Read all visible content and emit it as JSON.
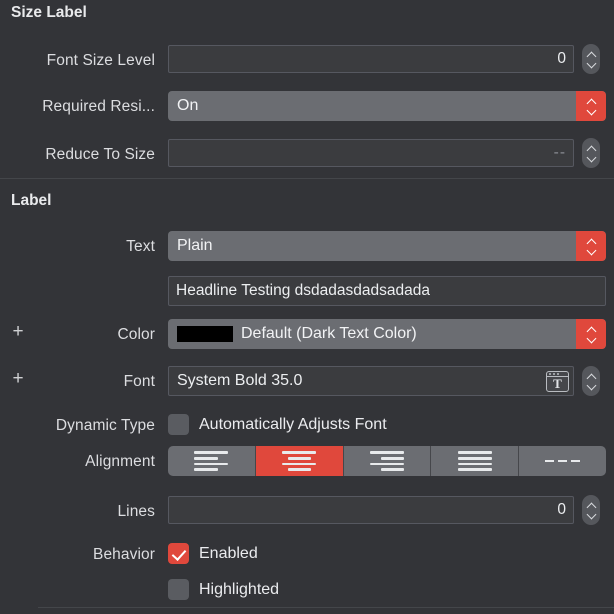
{
  "sections": {
    "size_label": {
      "title": "Size Label"
    },
    "label": {
      "title": "Label"
    }
  },
  "rows": {
    "font_size_level": {
      "label": "Font Size Level",
      "value": "0"
    },
    "required_resistance": {
      "label": "Required Resi...",
      "value": "On"
    },
    "reduce_to_size": {
      "label": "Reduce To Size",
      "value": "--"
    },
    "text": {
      "label": "Text",
      "value": "Plain"
    },
    "text_content": {
      "value": "Headline Testing dsdadasdadsadada"
    },
    "color": {
      "label": "Color",
      "value": "Default (Dark Text Color)",
      "swatch": "#000000"
    },
    "font": {
      "label": "Font",
      "value": "System Bold 35.0"
    },
    "dynamic_type": {
      "label": "Dynamic Type",
      "checkbox_label": "Automatically Adjusts Font",
      "checked": false
    },
    "alignment": {
      "label": "Alignment",
      "options": [
        "align-left",
        "align-center",
        "align-right",
        "align-justified",
        "align-natural"
      ],
      "selected_index": 1
    },
    "lines": {
      "label": "Lines",
      "value": "0"
    },
    "behavior": {
      "label": "Behavior",
      "enabled_label": "Enabled",
      "enabled_checked": true,
      "highlighted_label": "Highlighted",
      "highlighted_checked": false
    }
  },
  "icons": {
    "add": "+",
    "font_picker": "T"
  },
  "colors": {
    "accent": "#e0483c",
    "panel_bg": "#333438",
    "field_bg": "#3b3c3f",
    "control_bg": "#6b6d72",
    "text": "#ebecef"
  }
}
